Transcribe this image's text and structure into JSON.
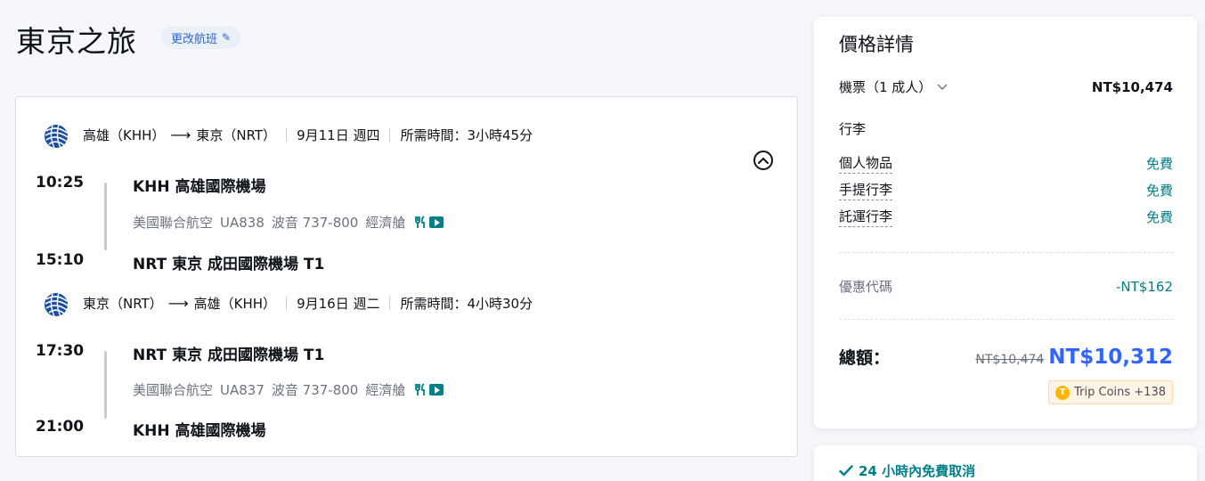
{
  "header": {
    "title": "東京之旅",
    "change_flight_label": "更改航班",
    "change_icon": "pencil-icon"
  },
  "segments": [
    {
      "route_from": "高雄（KHH）",
      "route_to": "東京（NRT）",
      "date": "9月11日 週四",
      "duration": "所需時間：3小時45分",
      "depart_time": "10:25",
      "depart_airport": "KHH 高雄國際機場",
      "airline": "美國聯合航空",
      "flight_no": "UA838",
      "aircraft": "波音 737-800",
      "cabin": "經濟艙",
      "arrive_time": "15:10",
      "arrive_airport": "NRT 東京 成田國際機場 T1"
    },
    {
      "route_from": "東京（NRT）",
      "route_to": "高雄（KHH）",
      "date": "9月16日 週二",
      "duration": "所需時間：4小時30分",
      "depart_time": "17:30",
      "depart_airport": "NRT 東京 成田國際機場 T1",
      "airline": "美國聯合航空",
      "flight_no": "UA837",
      "aircraft": "波音 737-800",
      "cabin": "經濟艙",
      "arrive_time": "21:00",
      "arrive_airport": "KHH 高雄國際機場"
    }
  ],
  "price": {
    "title": "價格詳情",
    "ticket_label": "機票（1 成人）",
    "ticket_price": "NT$10,474",
    "baggage_title": "行李",
    "baggage": [
      {
        "label": "個人物品",
        "value": "免費"
      },
      {
        "label": "手提行李",
        "value": "免費"
      },
      {
        "label": "託運行李",
        "value": "免費"
      }
    ],
    "promo_label": "優惠代碼",
    "promo_value": "-NT$162",
    "total_label": "總額：",
    "original_price": "NT$10,474",
    "total_price": "NT$10,312",
    "coins": "Trip Coins +138"
  },
  "cancel": {
    "label": "24 小時內免費取消"
  },
  "colors": {
    "accent_blue": "#3264ff",
    "teal": "#00808a",
    "coin": "#ffb400"
  }
}
